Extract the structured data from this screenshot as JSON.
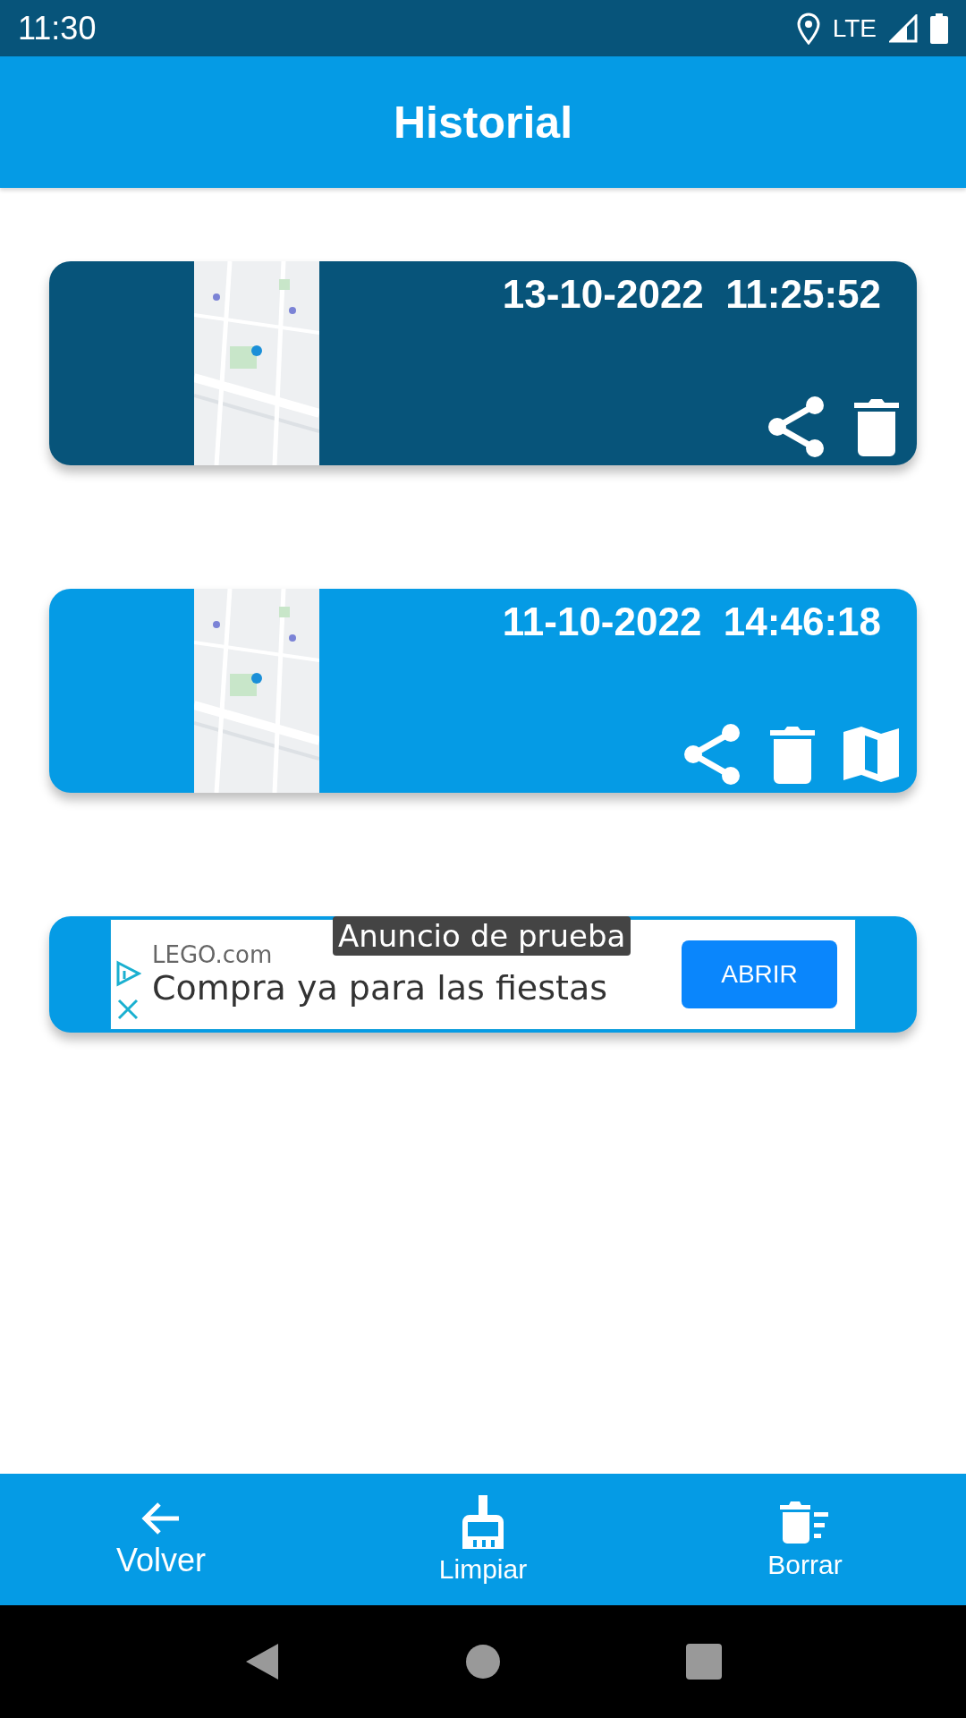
{
  "status_bar": {
    "time": "11:30",
    "network": "LTE"
  },
  "app_bar": {
    "title": "Historial"
  },
  "records": [
    {
      "datetime": "13-10-2022  11:25:52",
      "selected": true,
      "actions": [
        {
          "kind": "share"
        },
        {
          "kind": "delete"
        }
      ]
    },
    {
      "datetime": "11-10-2022  14:46:18",
      "selected": false,
      "actions": [
        {
          "kind": "share"
        },
        {
          "kind": "delete"
        },
        {
          "kind": "map"
        }
      ]
    }
  ],
  "ad": {
    "label": "Anuncio de prueba",
    "advertiser": "LEGO.com",
    "headline": "Compra ya para las fiestas",
    "button": "ABRIR"
  },
  "bottom_nav": [
    {
      "kind": "back",
      "label": "Volver"
    },
    {
      "kind": "clean",
      "label": "Limpiar"
    },
    {
      "kind": "delete_all",
      "label": "Borrar"
    }
  ]
}
